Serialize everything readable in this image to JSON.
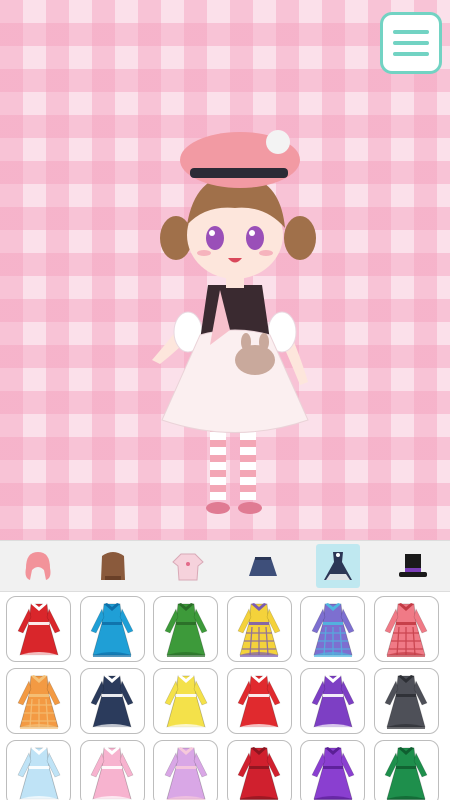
{
  "categories": [
    {
      "id": "hair-front",
      "icon": "pink-hair-icon",
      "color": "#f2939a"
    },
    {
      "id": "hair-back",
      "icon": "brown-hair-icon",
      "color": "#8a5a3c"
    },
    {
      "id": "tops",
      "icon": "blouse-icon",
      "color": "#f6d2dc"
    },
    {
      "id": "skirts",
      "icon": "skirt-icon",
      "color": "#3e4f7a"
    },
    {
      "id": "dresses",
      "icon": "dress-icon",
      "color": "#2c3655",
      "active": true
    },
    {
      "id": "hats",
      "icon": "top-hat-icon",
      "color": "#1a1a1a"
    }
  ],
  "dresses": [
    {
      "name": "red-coat-dress",
      "body": "#d9262b",
      "trim": "#ffffff",
      "pattern": "plain"
    },
    {
      "name": "blue-coat-dress",
      "body": "#1f9fd6",
      "trim": "#0e6fa8",
      "pattern": "plain"
    },
    {
      "name": "green-coat-dress",
      "body": "#3d9a3a",
      "trim": "#2a6d28",
      "pattern": "plain"
    },
    {
      "name": "yellow-plaid-dress",
      "body": "#f4d23b",
      "trim": "#7a5cb0",
      "pattern": "plaid"
    },
    {
      "name": "purple-plaid-dress",
      "body": "#7d6fd0",
      "trim": "#4fb7df",
      "pattern": "plaid"
    },
    {
      "name": "pink-plaid-dress",
      "body": "#f07a86",
      "trim": "#c23a44",
      "pattern": "plaid"
    },
    {
      "name": "orange-plaid-dress",
      "body": "#f39a43",
      "trim": "#f4c27a",
      "pattern": "plaid"
    },
    {
      "name": "navy-dress",
      "body": "#2b3b5c",
      "trim": "#ffffff",
      "pattern": "plain"
    },
    {
      "name": "yellow-dress",
      "body": "#f4e14a",
      "trim": "#ffffff",
      "pattern": "plain"
    },
    {
      "name": "red-dress",
      "body": "#e02a2e",
      "trim": "#ffffff",
      "pattern": "plain"
    },
    {
      "name": "violet-dress",
      "body": "#7d3fc4",
      "trim": "#ffffff",
      "pattern": "plain"
    },
    {
      "name": "gray-dress",
      "body": "#4e5058",
      "trim": "#2d2f35",
      "pattern": "plain"
    },
    {
      "name": "light-blue-dress",
      "body": "#bfe3f6",
      "trim": "#ffffff",
      "pattern": "plain"
    },
    {
      "name": "pink-dress",
      "body": "#f7b3cf",
      "trim": "#ffffff",
      "pattern": "plain"
    },
    {
      "name": "lavender-gradient-dress",
      "body": "#d9a7e6",
      "trim": "#f6c9db",
      "pattern": "plain"
    },
    {
      "name": "red-qipao",
      "body": "#d0202e",
      "trim": "#8c1520",
      "pattern": "plain"
    },
    {
      "name": "purple-qipao",
      "body": "#8a3fd0",
      "trim": "#5a1f96",
      "pattern": "plain"
    },
    {
      "name": "green-qipao",
      "body": "#1e8f4c",
      "trim": "#0f5f30",
      "pattern": "plain"
    }
  ]
}
